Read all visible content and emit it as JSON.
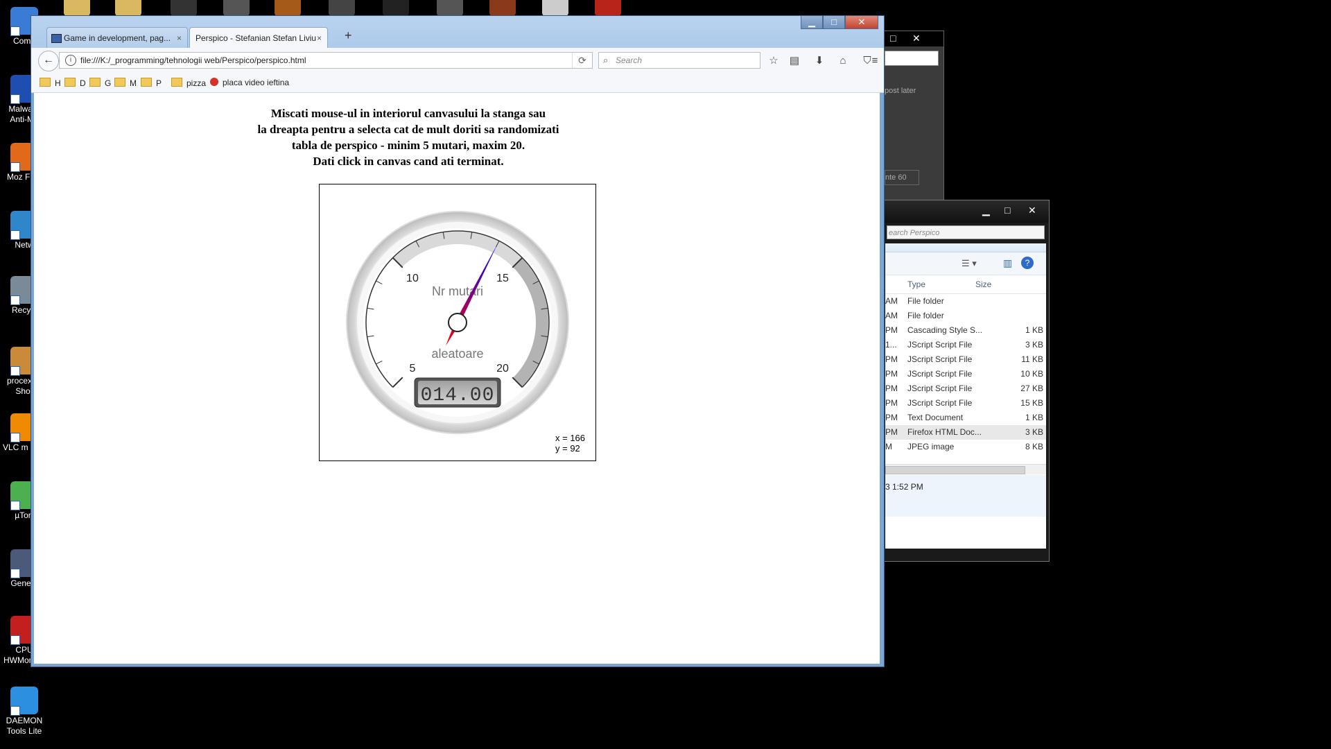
{
  "desktop": {
    "icons": [
      {
        "label": "Comp",
        "color": "#3a7bd5"
      },
      {
        "label": "Malware Anti-Ma",
        "color": "#1e4fb0"
      },
      {
        "label": "Moz Firef",
        "color": "#e06a1a"
      },
      {
        "label": "Netw",
        "color": "#2f86c9"
      },
      {
        "label": "Recycl",
        "color": "#7a8a99"
      },
      {
        "label": "procexp - Shor",
        "color": "#c98a3a"
      },
      {
        "label": "VLC m play",
        "color": "#f08a00"
      },
      {
        "label": "µTorr",
        "color": "#4caf50"
      },
      {
        "label": "Genefo",
        "color": "#4a5a78"
      },
      {
        "label": "CPU HWMonitor",
        "color": "#c41f1f"
      },
      {
        "label": "DAEMON Tools Lite",
        "color": "#2d8fe0"
      }
    ]
  },
  "browser": {
    "tabs": [
      {
        "label": "Game in development, pag...",
        "active": false
      },
      {
        "label": "Perspico - Stefanian Stefan Liviu",
        "active": true
      }
    ],
    "close_glyph": "×",
    "new_tab_glyph": "+",
    "url": "file:///K:/_programming/tehnologii web/Perspico/perspico.html",
    "search_placeholder": "Search",
    "bookmarks": [
      "H",
      "D",
      "G",
      "M",
      "P",
      "pizza",
      "placa video ieftina"
    ],
    "window_buttons": {
      "minimize": "▁",
      "maximize": "□",
      "close": "✕"
    }
  },
  "page": {
    "instructions": [
      "Miscati mouse-ul in interiorul canvasului la stanga sau",
      "la dreapta pentru a selecta cat de mult doriti sa randomizati",
      "tabla de perspico - minim 5 mutari, maxim 20.",
      "Dati click in canvas cand ati terminat."
    ],
    "coords": {
      "x_text": "x = 166",
      "y_text": "y = 92"
    }
  },
  "gauge": {
    "title_top": "Nr mutari",
    "title_bottom": "aleatoare",
    "min": 5,
    "max": 20,
    "value": 14,
    "tick_labels": [
      "5",
      "10",
      "15",
      "20"
    ],
    "display": "014.00",
    "colors": {
      "needle_start": "#ff0000",
      "needle_end": "#0000ff",
      "band_light": "#d9d9d9",
      "band_dark": "#b3b3b3"
    }
  },
  "explorer": {
    "search_placeholder": "earch Perspico",
    "columns": {
      "type": "Type",
      "size": "Size"
    },
    "rows": [
      {
        "time": "AM",
        "type": "File folder",
        "size": ""
      },
      {
        "time": "AM",
        "type": "File folder",
        "size": ""
      },
      {
        "time": "PM",
        "type": "Cascading Style S...",
        "size": "1 KB"
      },
      {
        "time": "1...",
        "type": "JScript Script File",
        "size": "3 KB"
      },
      {
        "time": "PM",
        "type": "JScript Script File",
        "size": "11 KB"
      },
      {
        "time": "PM",
        "type": "JScript Script File",
        "size": "10 KB"
      },
      {
        "time": "PM",
        "type": "JScript Script File",
        "size": "27 KB"
      },
      {
        "time": "PM",
        "type": "JScript Script File",
        "size": "15 KB"
      },
      {
        "time": "PM",
        "type": "Text Document",
        "size": "1 KB"
      },
      {
        "time": "PM",
        "type": "Firefox HTML Doc...",
        "size": "3 KB"
      },
      {
        "time": "M",
        "type": "JPEG image",
        "size": "8 KB"
      }
    ],
    "status_date": "3 1:52 PM"
  },
  "bg_window": {
    "text_top": "post later",
    "text_mid": "nte 60"
  }
}
